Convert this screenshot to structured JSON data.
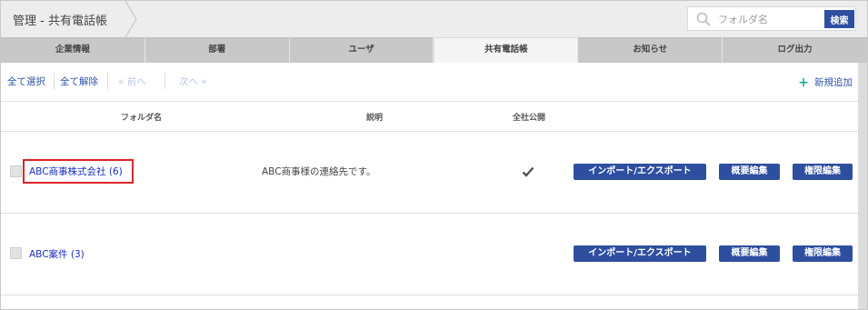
{
  "header": {
    "title": "管理 - 共有電話帳",
    "search_placeholder": "フォルダ名",
    "search_button": "検索"
  },
  "tabs": [
    {
      "label": "企業情報",
      "active": false
    },
    {
      "label": "部署",
      "active": false
    },
    {
      "label": "ユーザ",
      "active": false
    },
    {
      "label": "共有電話帳",
      "active": true
    },
    {
      "label": "お知らせ",
      "active": false
    },
    {
      "label": "ログ出力",
      "active": false
    }
  ],
  "toolbar": {
    "select_all": "全て選択",
    "deselect_all": "全て解除",
    "prev": "前へ",
    "next": "次へ",
    "new_add": "新規追加"
  },
  "table": {
    "columns": {
      "folder": "フォルダ名",
      "description": "説明",
      "public": "全社公開"
    },
    "rows": [
      {
        "folder": "ABC商事株式会社 (6)",
        "description": "ABC商事様の連絡先です。",
        "public": true
      },
      {
        "folder": "ABC案件 (3)",
        "description": "",
        "public": false
      }
    ],
    "actions": {
      "import_export": "インポート/エクスポート",
      "edit_summary": "概要編集",
      "edit_permission": "権限編集"
    }
  },
  "colors": {
    "accent": "#2e4fa0",
    "link": "#1a2fc0",
    "highlight": "#d9262c",
    "add_icon": "#24a99a"
  },
  "icons": [
    "search-icon",
    "chevron-right-icon",
    "plus-icon",
    "check-icon",
    "double-chevron-left-icon",
    "double-chevron-right-icon"
  ]
}
